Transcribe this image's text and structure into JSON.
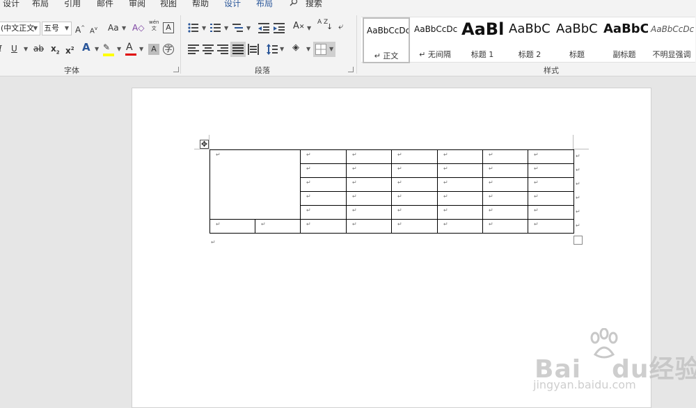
{
  "colors": {
    "accent": "#2b579a",
    "highlight": "#ffff00",
    "font_color": "#e00000"
  },
  "tabs": [
    {
      "label": "设计",
      "accent": false
    },
    {
      "label": "布局",
      "accent": false
    },
    {
      "label": "引用",
      "accent": false
    },
    {
      "label": "邮件",
      "accent": false
    },
    {
      "label": "审阅",
      "accent": false
    },
    {
      "label": "视图",
      "accent": false
    },
    {
      "label": "帮助",
      "accent": false
    },
    {
      "label": "设计",
      "accent": true
    },
    {
      "label": "布局",
      "accent": true
    }
  ],
  "search": {
    "label": "搜索",
    "icon": "search-icon"
  },
  "font": {
    "group_label": "字体",
    "name_value": "(中文正文",
    "size_value": "五号",
    "grow": "A",
    "shrink": "A",
    "case": "Aa",
    "clear": "A",
    "phonetic_top": "wén",
    "phonetic_bottom": "文",
    "border_char": "A",
    "italic": "I",
    "underline": "U",
    "strike": "ab",
    "subscript_base": "x",
    "subscript_mark": "2",
    "superscript_base": "x",
    "superscript_mark": "2",
    "text_effect": "A",
    "font_color": "A",
    "char_shading": "A",
    "enclose": "字"
  },
  "paragraph": {
    "group_label": "段落",
    "sort": "A Z"
  },
  "styles": {
    "group_label": "样式",
    "items": [
      {
        "preview": "AaBbCcDc",
        "name": "↵ 正文",
        "size": 12,
        "weight": "normal",
        "italic": false
      },
      {
        "preview": "AaBbCcDc",
        "name": "↵ 无间隔",
        "size": 12,
        "weight": "normal",
        "italic": false
      },
      {
        "preview": "AaBl",
        "name": "标题 1",
        "size": 24,
        "weight": "bold",
        "italic": false
      },
      {
        "preview": "AaBbC",
        "name": "标题 2",
        "size": 18,
        "weight": "normal",
        "italic": false
      },
      {
        "preview": "AaBbC",
        "name": "标题",
        "size": 18,
        "weight": "normal",
        "italic": false
      },
      {
        "preview": "AaBbC",
        "name": "副标题",
        "size": 18,
        "weight": "bold",
        "italic": false
      },
      {
        "preview": "AaBbCcDc",
        "name": "不明显强调",
        "size": 12,
        "weight": "normal",
        "italic": true
      }
    ]
  },
  "document": {
    "cell_mark": "↵",
    "table_handle": "✥",
    "table": {
      "col_count": 8,
      "layout": [
        [
          {
            "rowspan": 5,
            "colspan": 2
          },
          1,
          1,
          1,
          1,
          1,
          1
        ],
        [
          1,
          1,
          1,
          1,
          1,
          1
        ],
        [
          1,
          1,
          1,
          1,
          1,
          1
        ],
        [
          1,
          1,
          1,
          1,
          1,
          1
        ],
        [
          1,
          1,
          1,
          1,
          1,
          1
        ],
        [
          1,
          1,
          1,
          1,
          1,
          1,
          1,
          1
        ]
      ]
    }
  },
  "watermark": {
    "brand_latin_1": "Bai",
    "brand_latin_2": "du",
    "brand_cn": "经验",
    "url": "jingyan.baidu.com"
  }
}
